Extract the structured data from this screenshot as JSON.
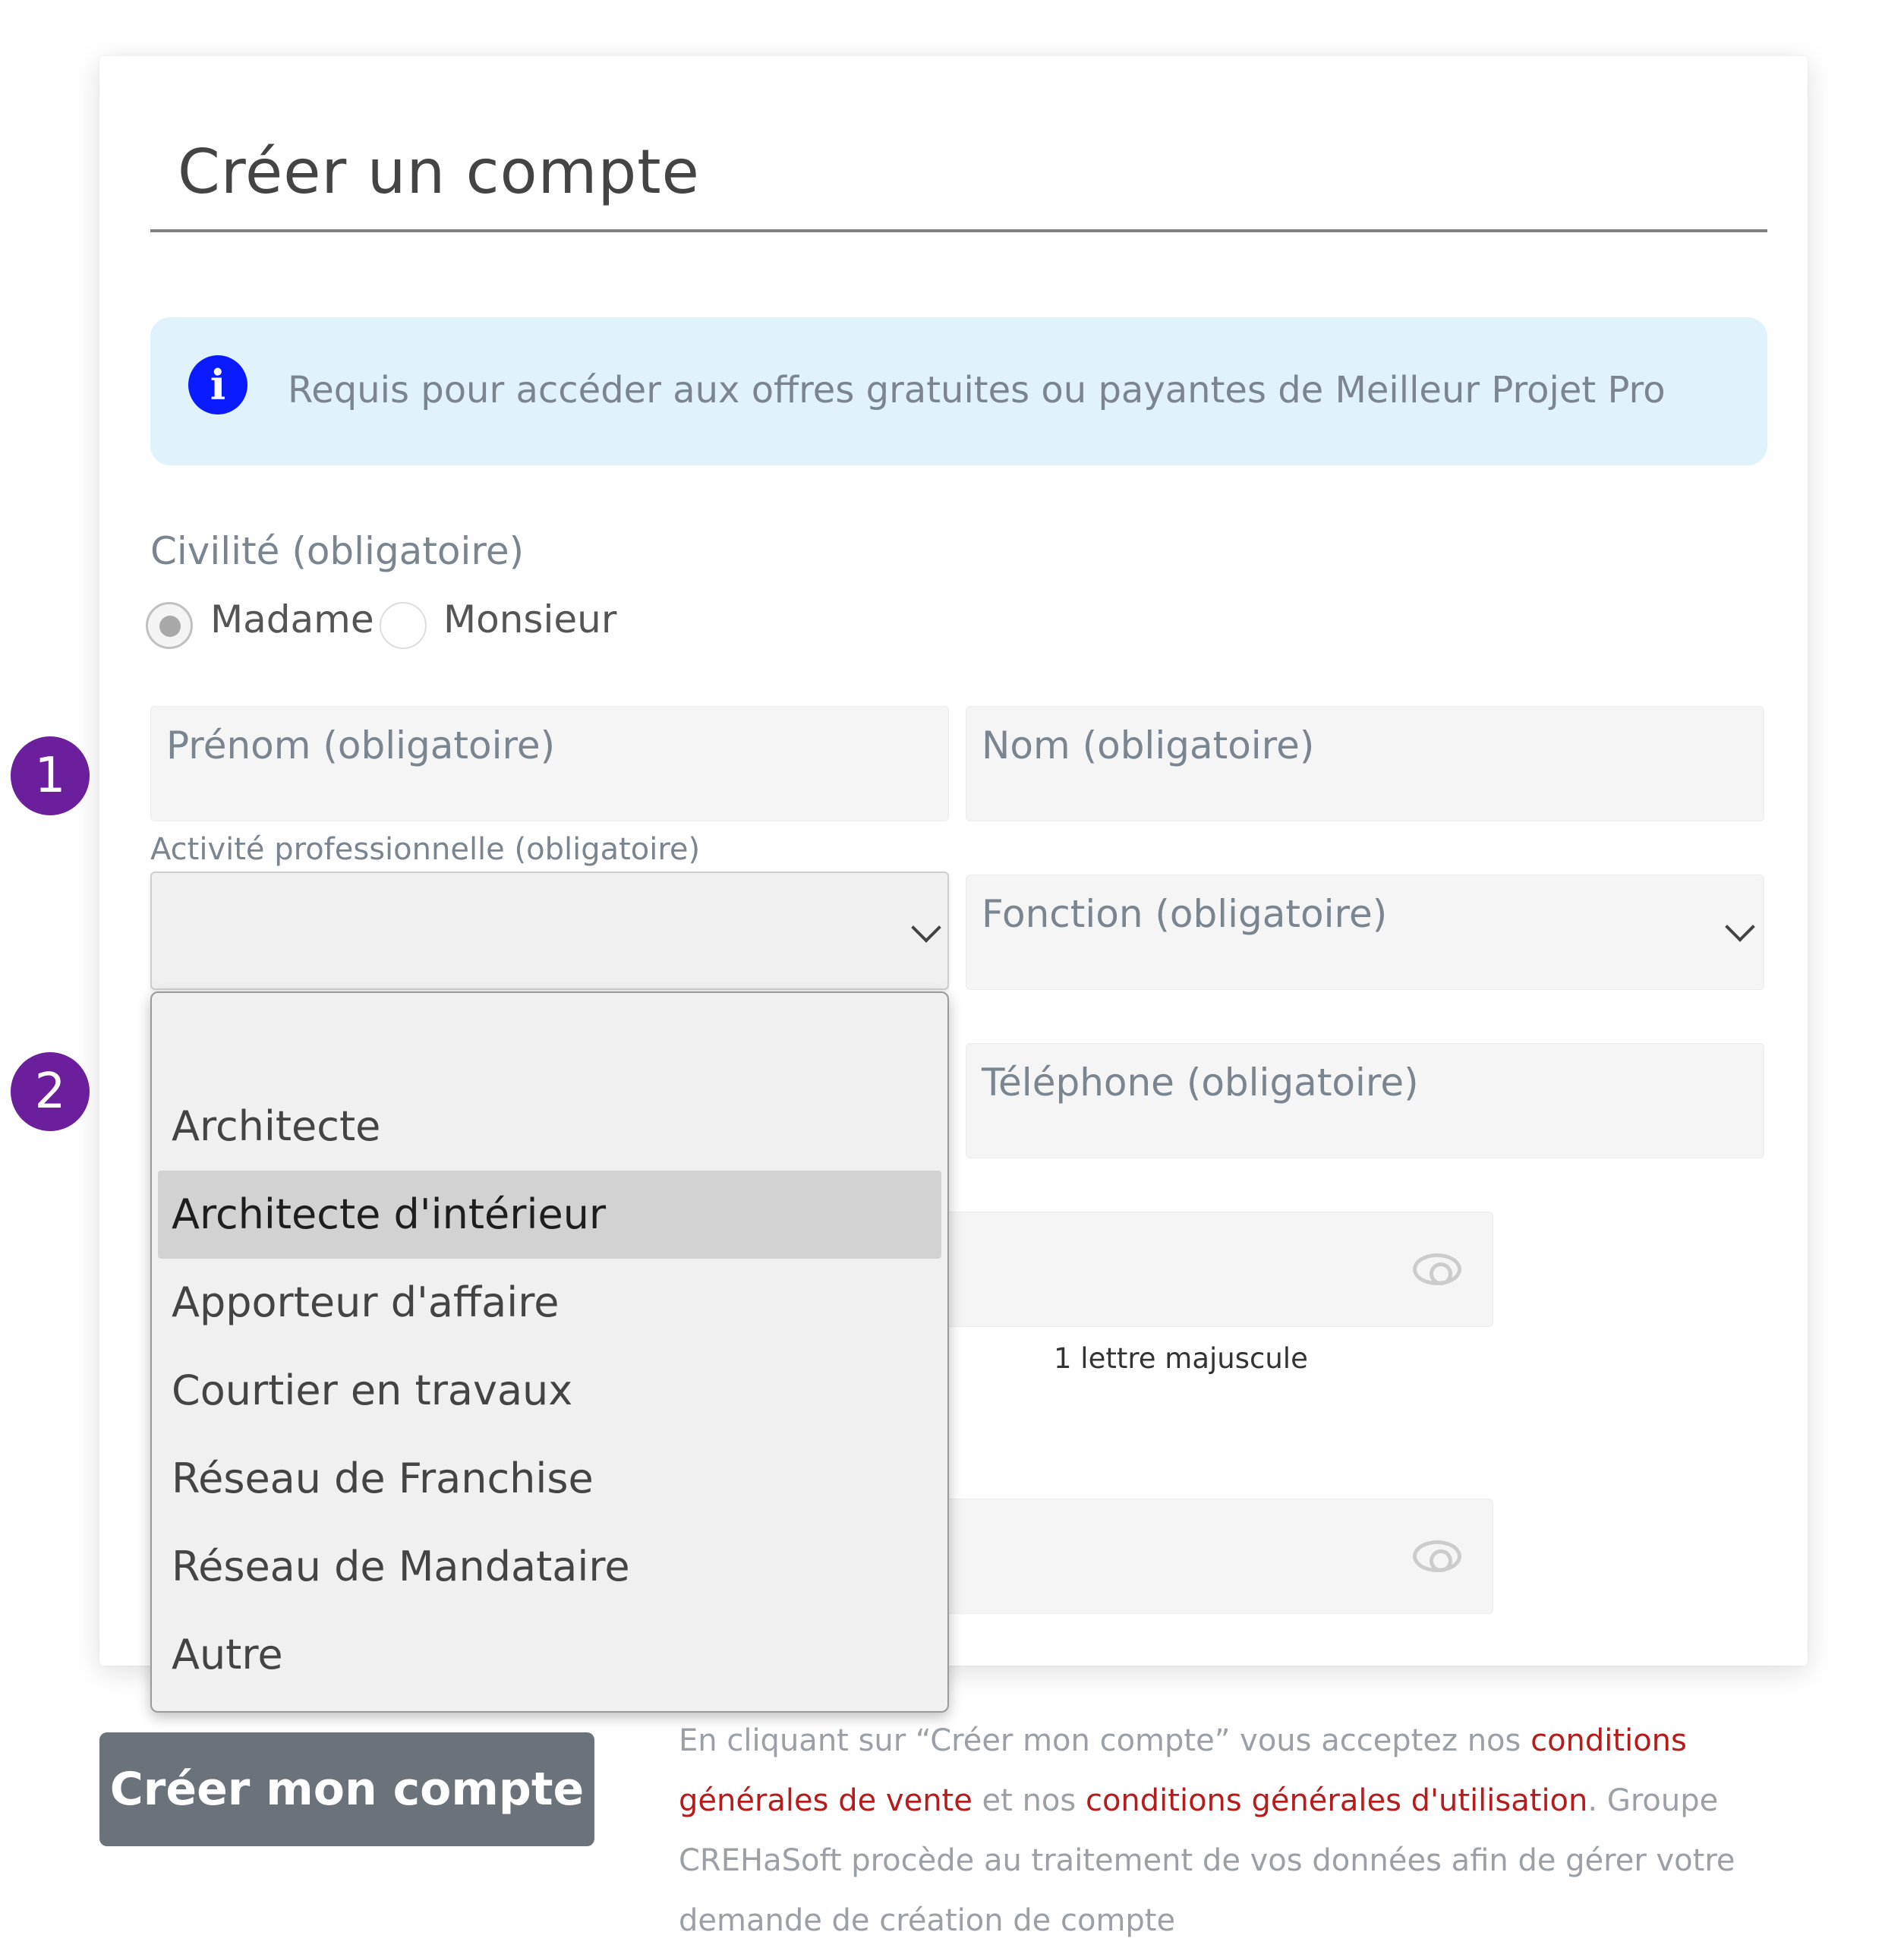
{
  "form": {
    "title": "Créer un compte",
    "info_icon": "info-icon",
    "info_text": "Requis pour accéder aux offres gratuites ou payantes de Meilleur Projet Pro",
    "civility": {
      "label": "Civilité (obligatoire)",
      "options": [
        "Madame",
        "Monsieur"
      ],
      "selected": "Madame"
    },
    "first_name_label": "Prénom (obligatoire)",
    "last_name_label": "Nom (obligatoire)",
    "activity": {
      "label": "Activité professionnelle (obligatoire)",
      "selected_value": "",
      "options": [
        "",
        "Architecte",
        "Architecte d'intérieur",
        "Apporteur d'affaire",
        "Courtier en travaux",
        "Réseau de Franchise",
        "Réseau de Mandataire",
        "Autre"
      ],
      "highlighted": "Architecte d'intérieur"
    },
    "function_label": "Fonction (obligatoire)",
    "phone_label": "Téléphone (obligatoire)",
    "password_hint": "1 lettre majuscule",
    "submit_label": "Créer mon compte",
    "legal": {
      "part1": "En cliquant sur “Créer mon compte” vous acceptez nos ",
      "link1": "conditions générales de vente",
      "part2": " et nos ",
      "link2": "conditions générales d'utilisation",
      "part3": ". Groupe CREHaSoft procède au traitement de vos données afin de gérer votre demande de création de compte"
    }
  },
  "annotations": {
    "marker1": "1",
    "marker2": "2"
  },
  "colors": {
    "info_background": "#e0f3fd",
    "info_icon": "#0a1cff",
    "marker": "#6b1f9c",
    "submit": "#6b727a",
    "link": "#b71c1c"
  }
}
